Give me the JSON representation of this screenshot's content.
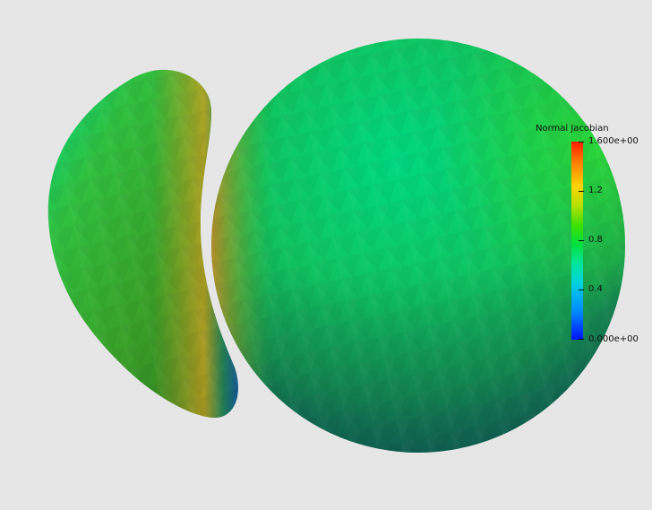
{
  "legend": {
    "title": "Normal Jacobian",
    "max_label": "1.600e+00",
    "min_label": "0.000e+00",
    "tick_labels": [
      "1.2",
      "0.8",
      "0.4"
    ],
    "colors": [
      "#ff1a00",
      "#ffd000",
      "#00e040",
      "#00d0e0",
      "#0010ff"
    ]
  },
  "colors": {
    "background": "#e6e6e6",
    "sphere_main": "#10c860",
    "sphere_top": "#00d870",
    "sphere_shadow": "#146a58",
    "kidney_main": "#2eaa30",
    "kidney_highlight": "#d0a020"
  }
}
